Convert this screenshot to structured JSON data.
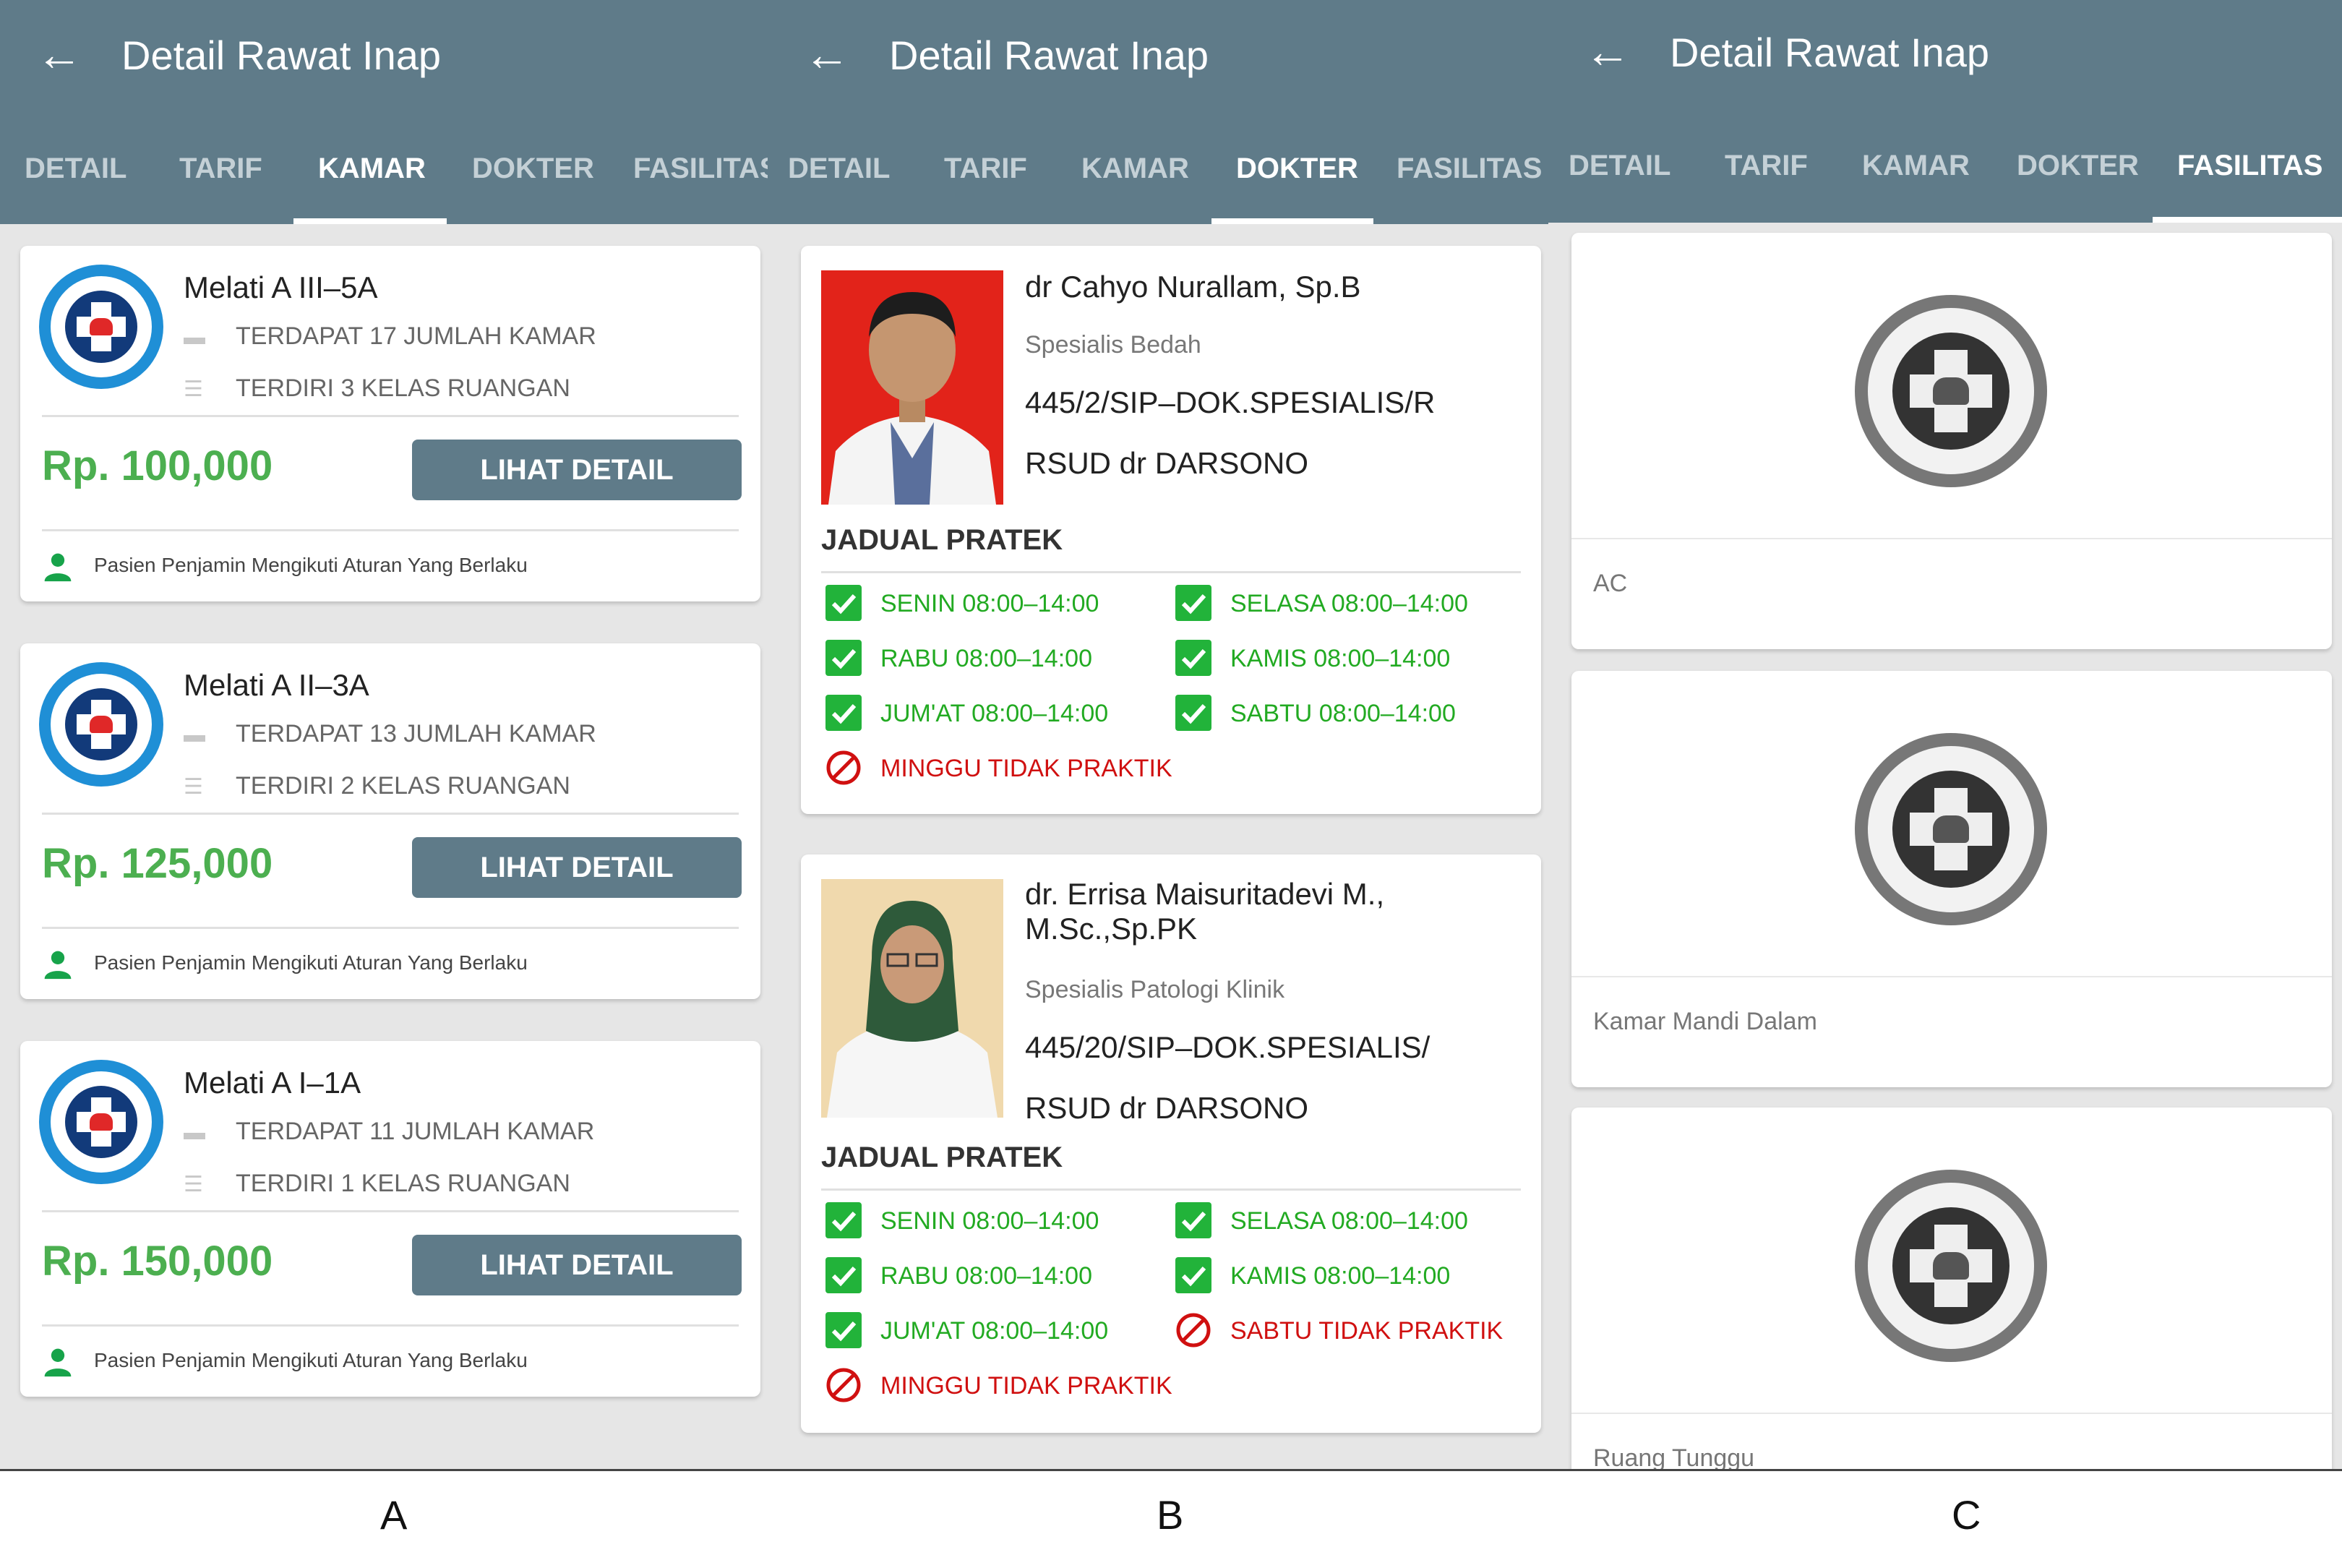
{
  "appbar": {
    "title": "Detail Rawat Inap"
  },
  "tabs": [
    "DETAIL",
    "TARIF",
    "KAMAR",
    "DOKTER",
    "FASILITAS"
  ],
  "active_tabs": {
    "A": "KAMAR",
    "B": "DOKTER",
    "C": "FASILITAS"
  },
  "colors": {
    "appbar": "#5f7b89",
    "price": "#4caf50",
    "available": "#22aa22",
    "unavailable": "#d01010"
  },
  "rooms": [
    {
      "name": "Melati A III–5A",
      "rooms_count": "TERDAPAT 17 JUMLAH KAMAR",
      "classes": "TERDIRI 3 KELAS RUANGAN",
      "price": "Rp. 100,000",
      "button": "LIHAT DETAIL",
      "note": "Pasien Penjamin Mengikuti Aturan Yang Berlaku"
    },
    {
      "name": "Melati A II–3A",
      "rooms_count": "TERDAPAT 13 JUMLAH KAMAR",
      "classes": "TERDIRI 2 KELAS RUANGAN",
      "price": "Rp. 125,000",
      "button": "LIHAT DETAIL",
      "note": "Pasien Penjamin Mengikuti Aturan Yang Berlaku"
    },
    {
      "name": "Melati A I–1A",
      "rooms_count": "TERDAPAT 11 JUMLAH KAMAR",
      "classes": "TERDIRI 1 KELAS RUANGAN",
      "price": "Rp. 150,000",
      "button": "LIHAT DETAIL",
      "note": "Pasien Penjamin Mengikuti Aturan Yang Berlaku"
    }
  ],
  "doctors": [
    {
      "name": "dr Cahyo Nurallam, Sp.B",
      "specialty": "Spesialis Bedah",
      "sip": "445/2/SIP–DOK.SPESIALIS/R",
      "hospital": "RSUD dr DARSONO",
      "schedule_title": "JADUAL PRATEK",
      "schedule": [
        {
          "text": "SENIN 08:00–14:00",
          "available": true
        },
        {
          "text": "SELASA 08:00–14:00",
          "available": true
        },
        {
          "text": "RABU 08:00–14:00",
          "available": true
        },
        {
          "text": "KAMIS 08:00–14:00",
          "available": true
        },
        {
          "text": "JUM'AT 08:00–14:00",
          "available": true
        },
        {
          "text": "SABTU  08:00–14:00",
          "available": true
        },
        {
          "text": "MINGGU TIDAK PRAKTIK",
          "available": false
        }
      ]
    },
    {
      "name_line1": "dr. Errisa Maisuritadevi M.,",
      "name_line2": "M.Sc.,Sp.PK",
      "specialty": "Spesialis Patologi Klinik",
      "sip": "445/20/SIP–DOK.SPESIALIS/",
      "hospital": "RSUD dr DARSONO",
      "schedule_title": "JADUAL PRATEK",
      "schedule": [
        {
          "text": "SENIN 08:00–14:00",
          "available": true
        },
        {
          "text": "SELASA 08:00–14:00",
          "available": true
        },
        {
          "text": "RABU 08:00–14:00",
          "available": true
        },
        {
          "text": "KAMIS 08:00–14:00",
          "available": true
        },
        {
          "text": "JUM'AT 08:00–14:00",
          "available": true
        },
        {
          "text": "SABTU TIDAK PRAKTIK",
          "available": false
        },
        {
          "text": "MINGGU TIDAK PRAKTIK",
          "available": false
        }
      ]
    }
  ],
  "facilities": [
    "AC",
    "Kamar Mandi Dalam",
    "Ruang Tunggu"
  ],
  "captions": [
    "A",
    "B",
    "C"
  ]
}
